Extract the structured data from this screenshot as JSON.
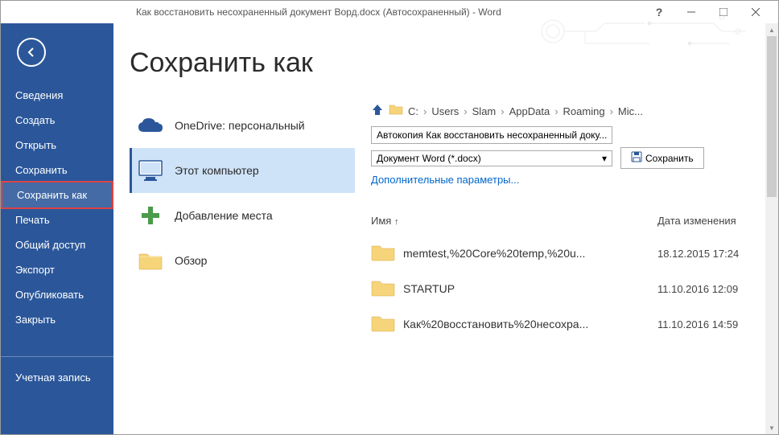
{
  "titlebar": {
    "title": "Как восстановить несохраненный документ Ворд.docx (Автосохраненный) - Word"
  },
  "sidebar": {
    "items": [
      {
        "label": "Сведения"
      },
      {
        "label": "Создать"
      },
      {
        "label": "Открыть"
      },
      {
        "label": "Сохранить"
      },
      {
        "label": "Сохранить как"
      },
      {
        "label": "Печать"
      },
      {
        "label": "Общий доступ"
      },
      {
        "label": "Экспорт"
      },
      {
        "label": "Опубликовать"
      },
      {
        "label": "Закрыть"
      }
    ],
    "account_label": "Учетная запись"
  },
  "page": {
    "title": "Сохранить как"
  },
  "places": [
    {
      "title": "OneDrive: персональный",
      "sub": ""
    },
    {
      "title": "Этот компьютер",
      "sub": ""
    },
    {
      "title": "Добавление места",
      "sub": ""
    },
    {
      "title": "Обзор",
      "sub": ""
    }
  ],
  "breadcrumb": {
    "parts": [
      "C:",
      "Users",
      "Slam",
      "AppData",
      "Roaming",
      "Mic..."
    ]
  },
  "filename": "Автокопия Как восстановить несохраненный доку...",
  "filetype": "Документ Word (*.docx)",
  "save_button_label": "Сохранить",
  "more_options": "Дополнительные параметры...",
  "filelist": {
    "headers": {
      "name": "Имя",
      "date": "Дата изменения"
    },
    "rows": [
      {
        "name": "memtest,%20Core%20temp,%20u...",
        "date": "18.12.2015 17:24"
      },
      {
        "name": "STARTUP",
        "date": "11.10.2016 12:09"
      },
      {
        "name": "Как%20восстановить%20несохра...",
        "date": "11.10.2016 14:59"
      }
    ]
  }
}
